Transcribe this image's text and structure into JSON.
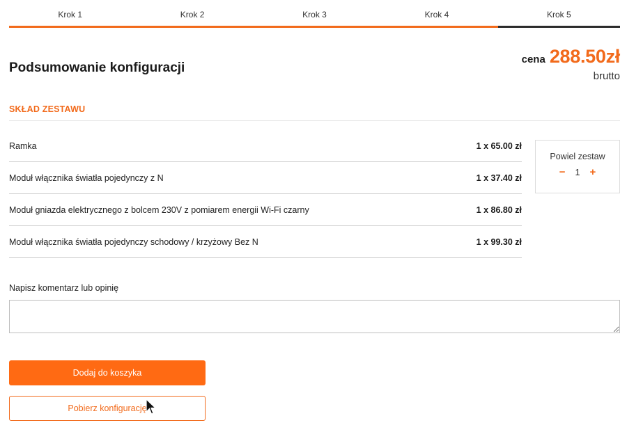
{
  "steps": [
    {
      "label": "Krok 1",
      "active": false
    },
    {
      "label": "Krok 2",
      "active": false
    },
    {
      "label": "Krok 3",
      "active": false
    },
    {
      "label": "Krok 4",
      "active": false
    },
    {
      "label": "Krok 5",
      "active": true
    }
  ],
  "header": {
    "title": "Podsumowanie konfiguracji",
    "price_prefix": "cena",
    "price_value": "288.50zł",
    "price_suffix": "brutto"
  },
  "section": {
    "label": "SKŁAD ZESTAWU"
  },
  "items": [
    {
      "name": "Ramka",
      "qty": "1 x 65.00 zł"
    },
    {
      "name": "Moduł włącznika światła pojedynczy z N",
      "qty": "1 x 37.40 zł"
    },
    {
      "name": "Moduł gniazda elektrycznego z bolcem 230V z pomiarem energii Wi-Fi czarny",
      "qty": "1 x 86.80 zł"
    },
    {
      "name": "Moduł włącznika światła pojedynczy schodowy / krzyżowy Bez N",
      "qty": "1 x 99.30 zł"
    }
  ],
  "duplicate": {
    "label": "Powiel zestaw",
    "minus": "−",
    "value": "1",
    "plus": "+"
  },
  "comment": {
    "label": "Napisz komentarz lub opinię",
    "value": ""
  },
  "actions": {
    "add_to_cart": "Dodaj do koszyka",
    "download_config": "Pobierz konfigurację"
  },
  "colors": {
    "accent": "#f26a1b",
    "button": "#ff6a13",
    "active_step": "#2b2b2b"
  }
}
